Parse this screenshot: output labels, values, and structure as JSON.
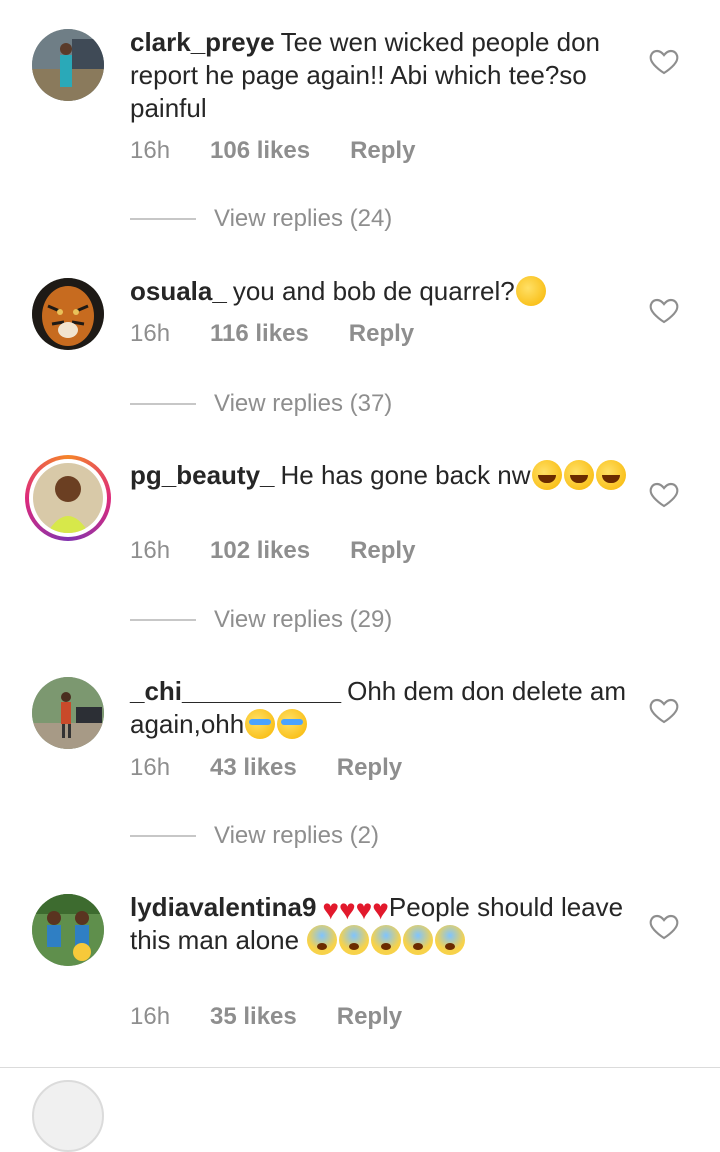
{
  "comments": [
    {
      "username": "clark_preye",
      "text": "Tee wen wicked people don report he page again!! Abi which tee?so painful",
      "time": "16h",
      "likes": "106 likes",
      "reply": "Reply",
      "view_replies": "View replies (24)"
    },
    {
      "username": "osuala_",
      "text": "you and bob de quarrel?",
      "time": "16h",
      "likes": "116 likes",
      "reply": "Reply",
      "view_replies": "View replies (37)"
    },
    {
      "username": "pg_beauty_",
      "text": "He has gone back nw",
      "time": "16h",
      "likes": "102 likes",
      "reply": "Reply",
      "view_replies": "View replies (29)"
    },
    {
      "username": "_chi___________",
      "text": "Ohh dem don delete am again,ohh",
      "time": "16h",
      "likes": "43 likes",
      "reply": "Reply",
      "view_replies": "View replies (2)"
    },
    {
      "username": "lydiavalentina9",
      "text_after_hearts": "People should leave this man alone",
      "time": "16h",
      "likes": "35 likes",
      "reply": "Reply"
    }
  ],
  "icons": {
    "like": "heart-outline-icon",
    "emoji_thinking": "thinking-face-emoji",
    "emoji_laughing": "tears-of-joy-emoji",
    "emoji_crying": "loudly-crying-emoji",
    "emoji_fearful": "anxious-face-emoji",
    "emoji_heart": "red-heart-emoji"
  },
  "colors": {
    "text": "#262626",
    "secondary": "#8e8e8e",
    "heart_red": "#e2192c"
  }
}
